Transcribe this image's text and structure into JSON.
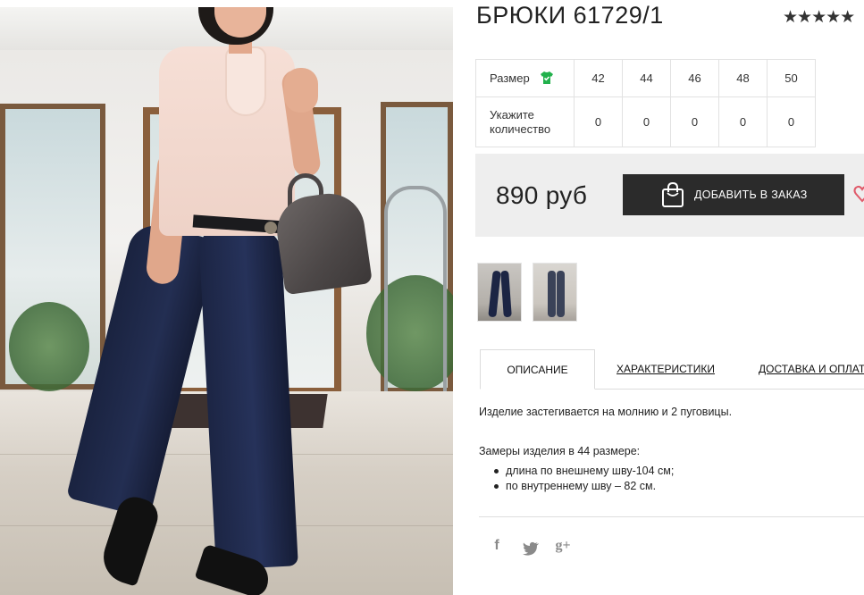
{
  "product": {
    "title": "БРЮКИ 61729/1",
    "rating_stars": "★★★★★"
  },
  "sizes": {
    "size_label": "Размер",
    "size_icon": "tshirt-check-icon",
    "values": [
      "42",
      "44",
      "46",
      "48",
      "50"
    ],
    "qty_label_line1": "Укажите",
    "qty_label_line2": "количество",
    "quantities": [
      "0",
      "0",
      "0",
      "0",
      "0"
    ]
  },
  "buy": {
    "price": "890 руб",
    "add_button_label": "ДОБАВИТЬ В ЗАКАЗ",
    "button_icon": "shopping-bag-icon",
    "wishlist_icon": "heart-icon"
  },
  "tabs": [
    {
      "label": "ОПИСАНИЕ",
      "active": true
    },
    {
      "label": "ХАРАКТЕРИСТИКИ",
      "active": false
    },
    {
      "label": "ДОСТАВКА И ОПЛАТА",
      "active": false
    }
  ],
  "description": {
    "text": "Изделие застегивается на молнию и 2 пуговицы.",
    "measure_heading": "Замеры изделия в 44 размере:",
    "measures": [
      "длина по внешнему шву-104 см;",
      "по внутреннему шву – 82 см."
    ]
  },
  "social": {
    "facebook": "f",
    "twitter_icon": "twitter-icon",
    "gplus": "g+"
  },
  "colors": {
    "button_bg": "#2b2b2b",
    "buybar_bg": "#eeeeee",
    "size_icon_color": "#22b14c"
  }
}
